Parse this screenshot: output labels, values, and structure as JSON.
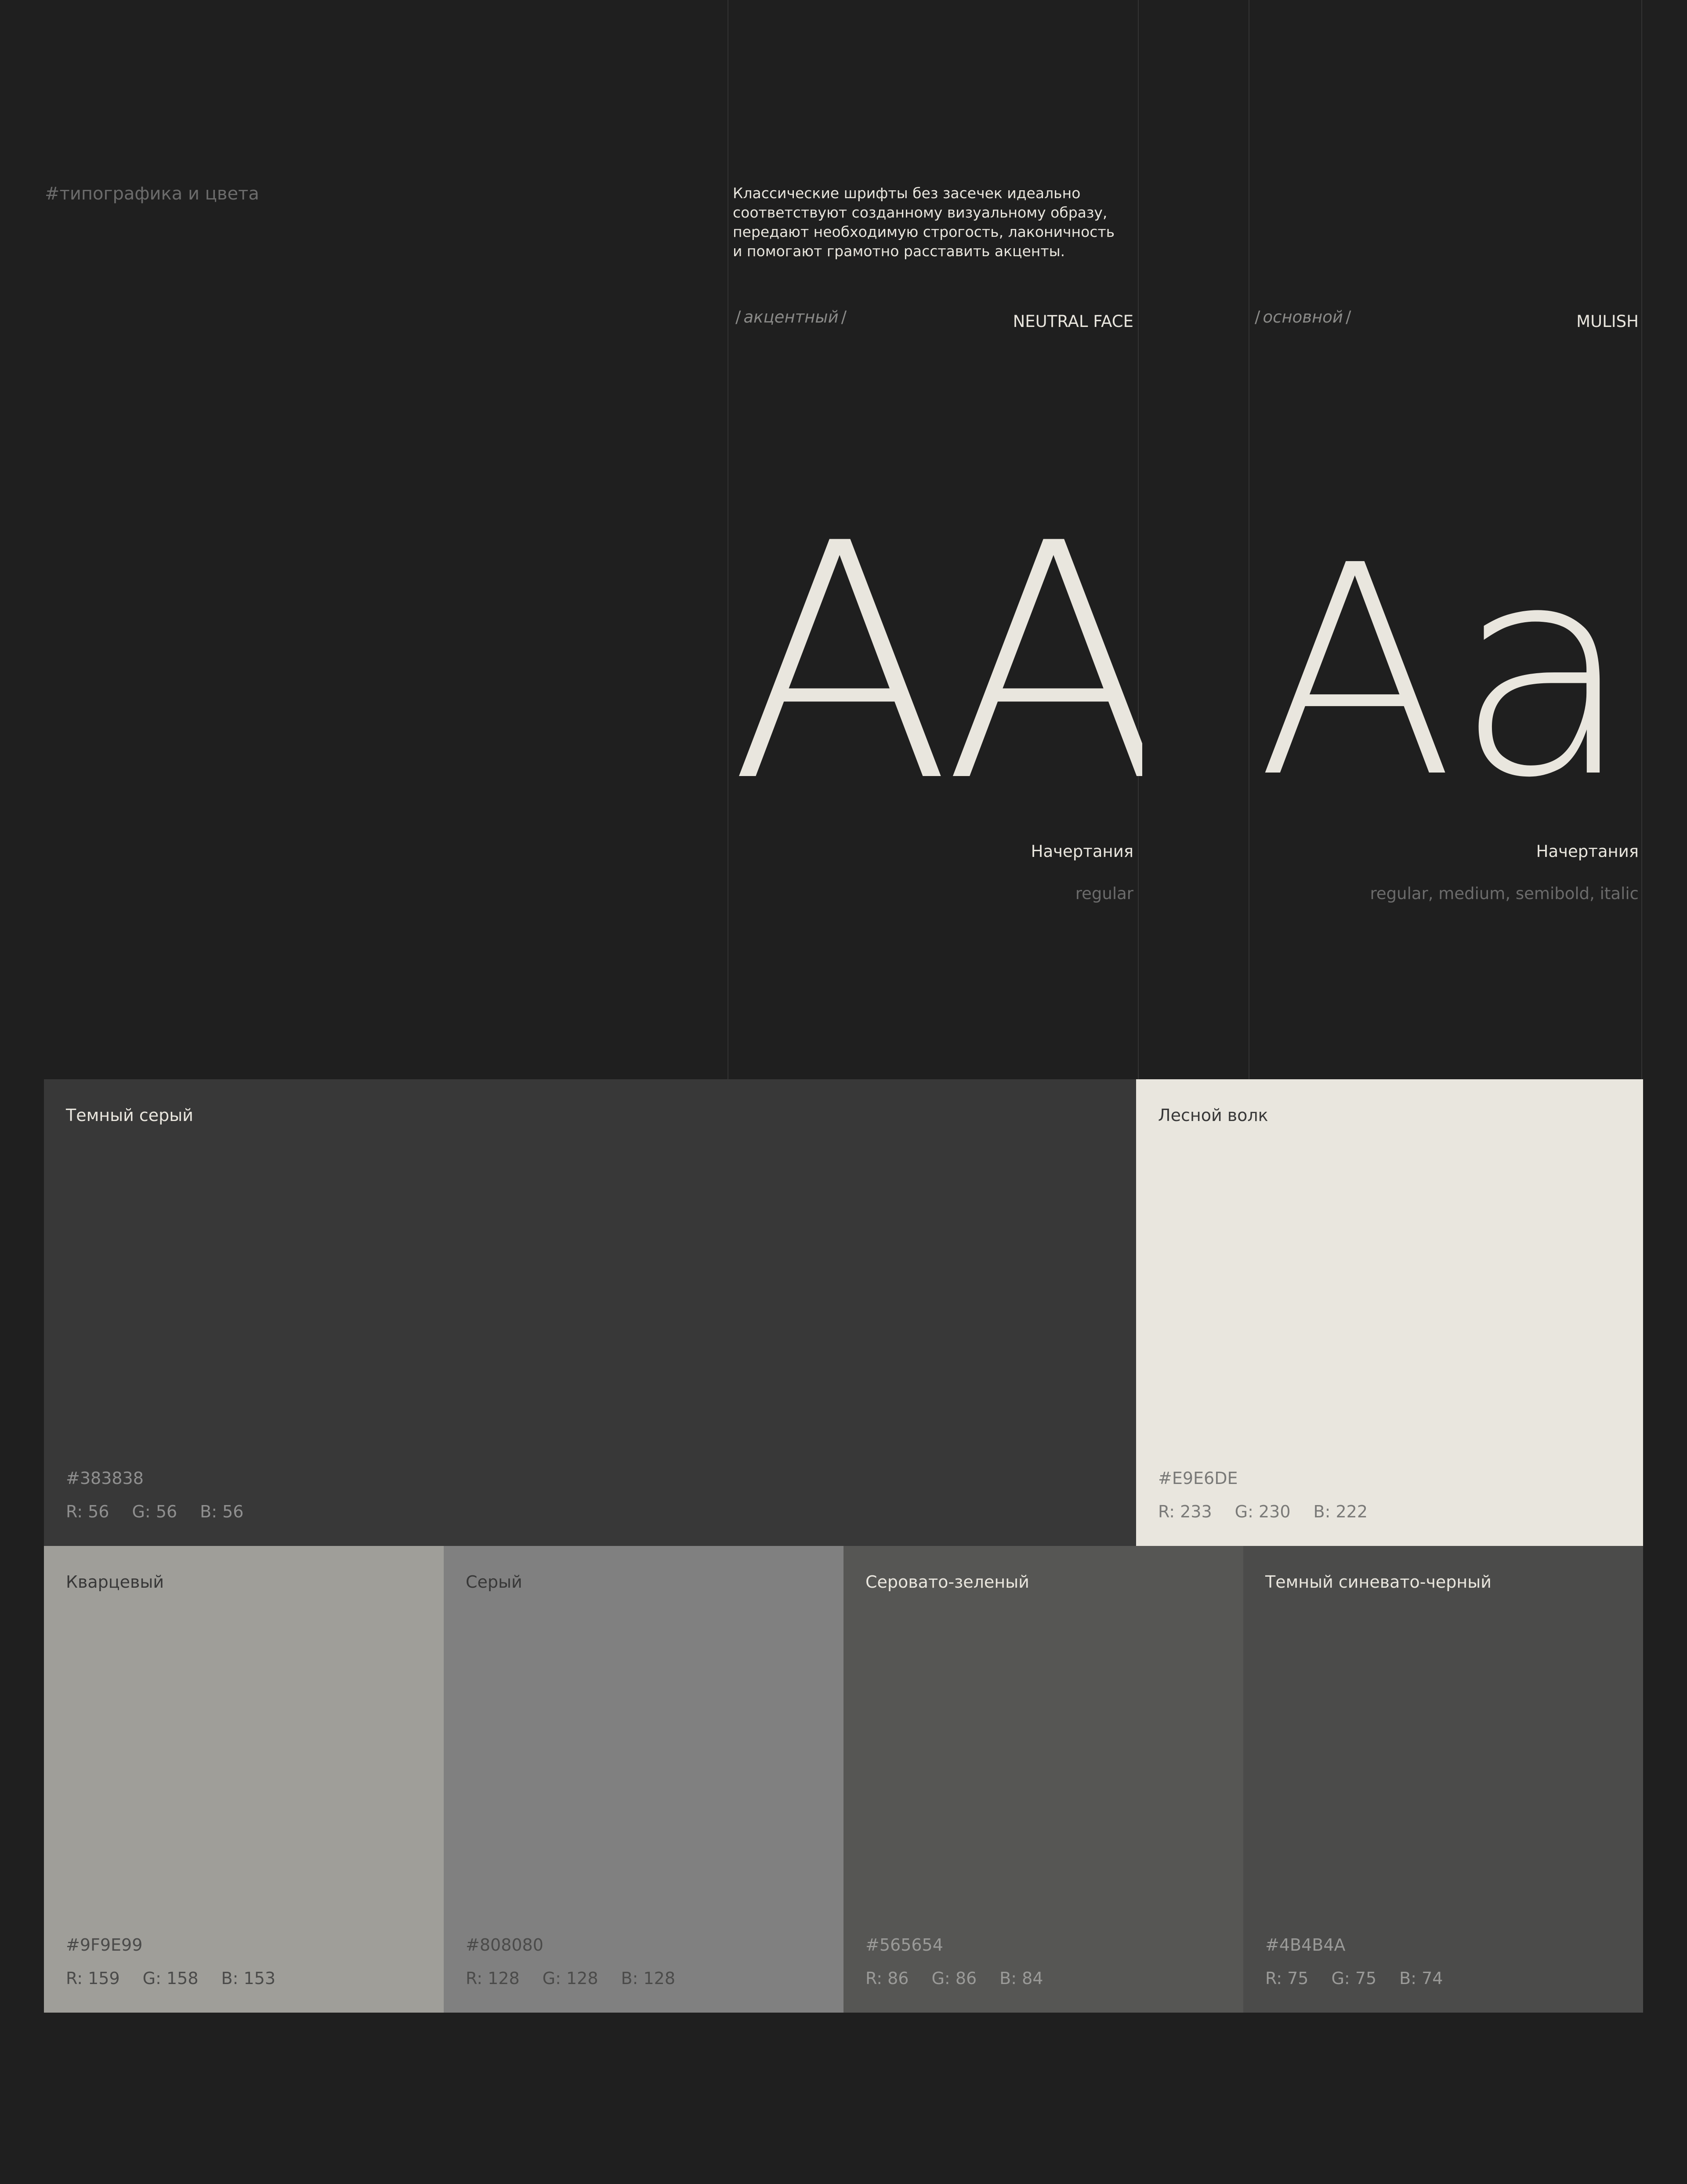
{
  "section_tag": "#типографика и цвета",
  "description": [
    "Классические шрифты без засечек идеально",
    "соответствуют созданному визуальному образу,",
    "передают необходимую строгость, лаконичность",
    "и помогают грамотно расставить акценты."
  ],
  "fonts": [
    {
      "role": "акцентный",
      "name": "NEUTRAL FACE",
      "sample": "AA",
      "styles_heading": "Начертания",
      "styles": "regular"
    },
    {
      "role": "основной",
      "name": "MULISH",
      "sample": "Aa",
      "styles_heading": "Начертания",
      "styles": "regular, medium, semibold, italic"
    }
  ],
  "colors": [
    {
      "name": "Темный серый",
      "hex": "#383838",
      "r": "R: 56",
      "g": "G: 56",
      "b": "B: 56",
      "bg": "#383838",
      "fg": "#e9e6de",
      "fg_muted": "#8f8f8f"
    },
    {
      "name": "Лесной волк",
      "hex": "#E9E6DE",
      "r": "R: 233",
      "g": "G: 230",
      "b": "B: 222",
      "bg": "#e9e6de",
      "fg": "#383838",
      "fg_muted": "#7a7a78"
    },
    {
      "name": "Кварцевый",
      "hex": "#9F9E99",
      "r": "R: 159",
      "g": "G: 158",
      "b": "B: 153",
      "bg": "#9f9e99",
      "fg": "#383838",
      "fg_muted": "#4b4b4a"
    },
    {
      "name": "Серый",
      "hex": "#808080",
      "r": "R: 128",
      "g": "G: 128",
      "b": "B: 128",
      "bg": "#808080",
      "fg": "#383838",
      "fg_muted": "#4b4b4a"
    },
    {
      "name": "Серовато-зеленый",
      "hex": "#565654",
      "r": "R: 86",
      "g": "G: 86",
      "b": "B: 84",
      "bg": "#565654",
      "fg": "#e9e6de",
      "fg_muted": "#9a9a98"
    },
    {
      "name": "Темный синевато-черный",
      "hex": "#4B4B4A",
      "r": "R: 75",
      "g": "G: 75",
      "b": "B: 74",
      "bg": "#4b4b4a",
      "fg": "#e9e6de",
      "fg_muted": "#9a9a98"
    }
  ]
}
